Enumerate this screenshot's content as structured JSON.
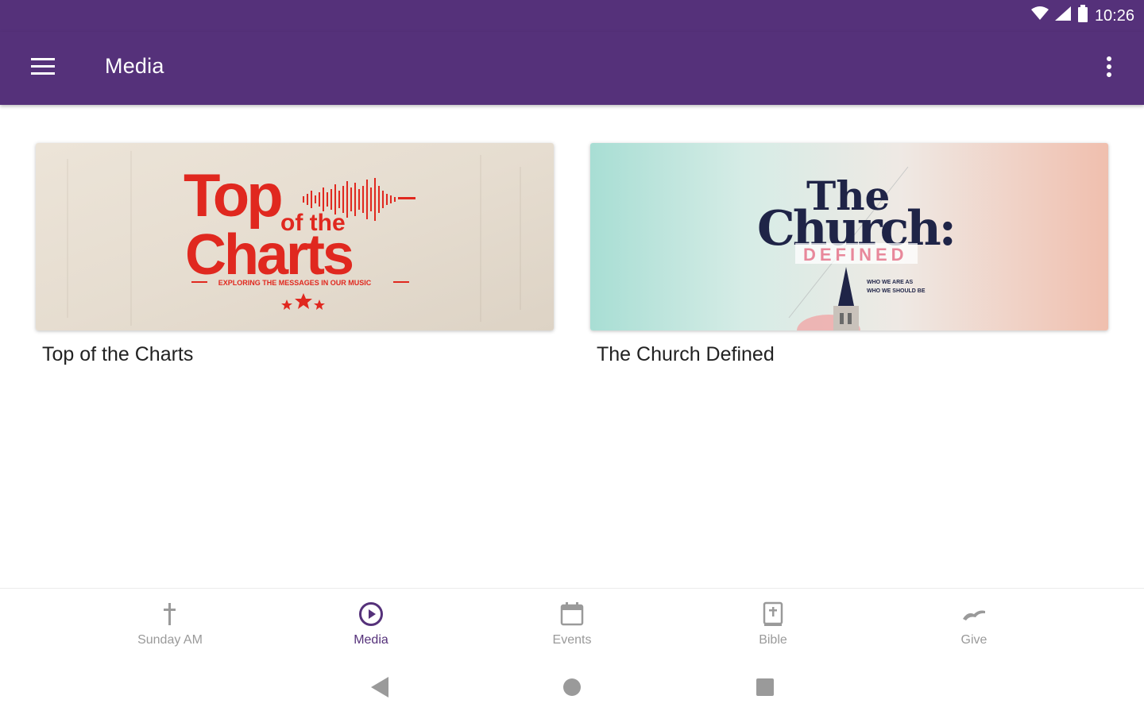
{
  "status_bar": {
    "time": "10:26",
    "icons": [
      "wifi-icon",
      "cell-signal-icon",
      "battery-icon"
    ]
  },
  "app_bar": {
    "title": "Media",
    "menu_icon": "hamburger-menu-icon",
    "overflow_icon": "more-vert-icon"
  },
  "cards": [
    {
      "title": "Top of the Charts",
      "art": {
        "line1": "Top",
        "line2": "of the",
        "line3": "Charts",
        "tagline": "EXPLORING THE MESSAGES IN OUR MUSIC"
      }
    },
    {
      "title": "The Church Defined",
      "art": {
        "line1": "The",
        "line2": "Church:",
        "line3": "DEFINED",
        "small1": "WHO WE ARE AS",
        "small2": "WHO WE SHOULD BE"
      }
    }
  ],
  "bottom_nav": {
    "items": [
      {
        "label": "Sunday AM",
        "icon": "cross-icon",
        "active": false
      },
      {
        "label": "Media",
        "icon": "play-circle-icon",
        "active": true
      },
      {
        "label": "Events",
        "icon": "calendar-icon",
        "active": false
      },
      {
        "label": "Bible",
        "icon": "bible-icon",
        "active": false
      },
      {
        "label": "Give",
        "icon": "give-hand-icon",
        "active": false
      }
    ]
  },
  "colors": {
    "primary": "#55317a",
    "inactive": "#9a9a9a",
    "chart_red": "#e0281f",
    "church_navy": "#1f2447"
  }
}
